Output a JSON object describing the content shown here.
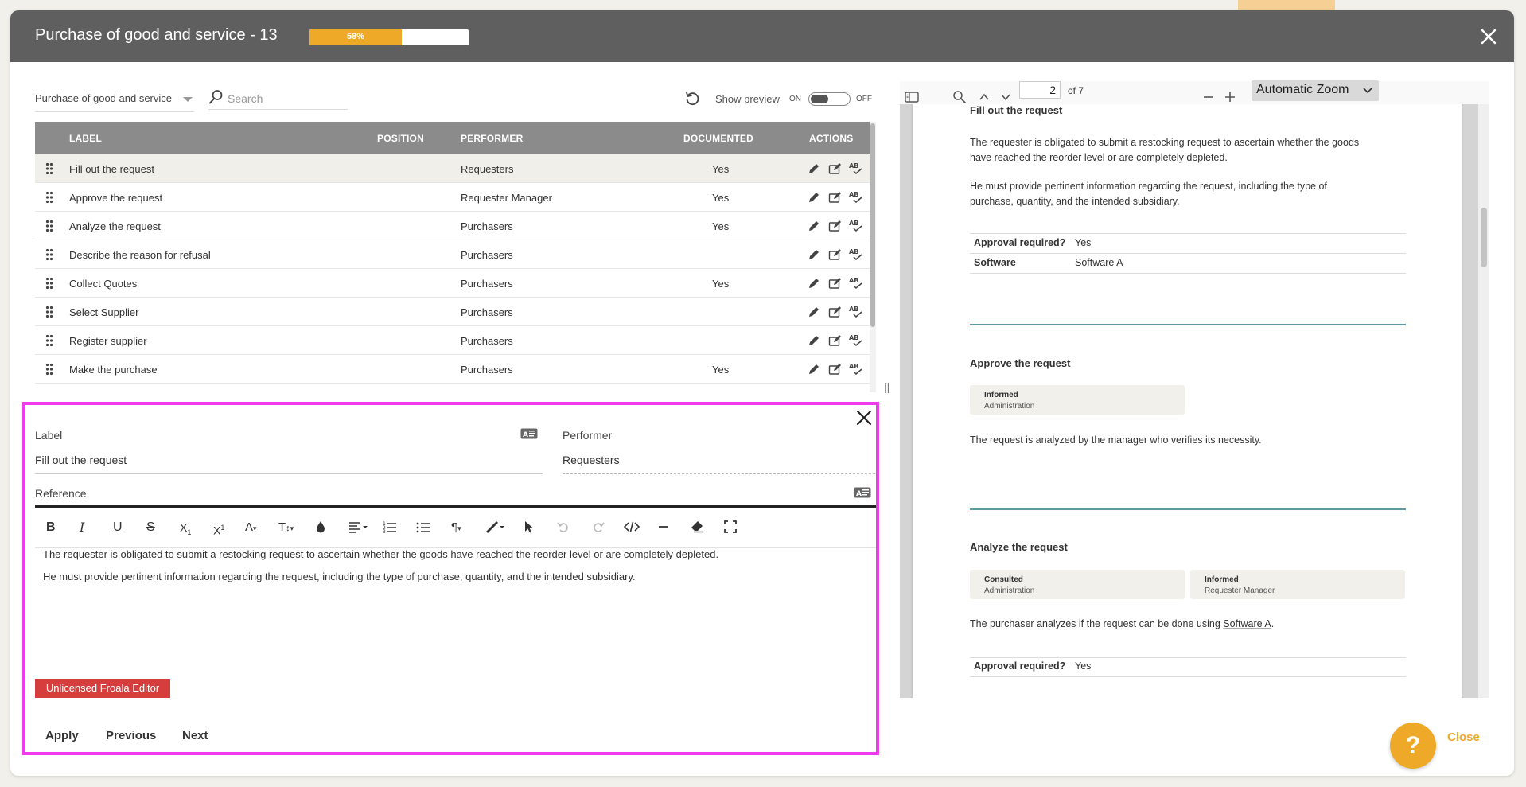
{
  "modal": {
    "title": "Purchase of good and service - 13",
    "progress_percent": 58,
    "progress_label": "58%"
  },
  "toolbar": {
    "filter_value": "Purchase of good and service",
    "search_placeholder": "Search",
    "show_preview_label": "Show preview",
    "toggle_on": "ON",
    "toggle_off": "OFF",
    "preview_enabled": true
  },
  "table": {
    "columns": [
      "LABEL",
      "POSITION",
      "PERFORMER",
      "DOCUMENTED",
      "ACTIONS"
    ],
    "rows": [
      {
        "label": "Fill out the request",
        "position": "",
        "performer": "Requesters",
        "documented": "Yes"
      },
      {
        "label": "Approve the request",
        "position": "",
        "performer": "Requester Manager",
        "documented": "Yes"
      },
      {
        "label": "Analyze the request",
        "position": "",
        "performer": "Purchasers",
        "documented": "Yes"
      },
      {
        "label": "Describe the reason for refusal",
        "position": "",
        "performer": "Purchasers",
        "documented": ""
      },
      {
        "label": "Collect Quotes",
        "position": "",
        "performer": "Purchasers",
        "documented": "Yes"
      },
      {
        "label": "Select Supplier",
        "position": "",
        "performer": "Purchasers",
        "documented": ""
      },
      {
        "label": "Register supplier",
        "position": "",
        "performer": "Purchasers",
        "documented": ""
      },
      {
        "label": "Make the purchase",
        "position": "",
        "performer": "Purchasers",
        "documented": "Yes"
      }
    ]
  },
  "edit_panel": {
    "label_title": "Label",
    "label_value": "Fill out the request",
    "performer_title": "Performer",
    "performer_value": "Requesters",
    "reference_title": "Reference",
    "editor_lines": [
      "The requester is obligated to submit a restocking request to ascertain whether the goods have reached the reorder level or are completely depleted.",
      "He must provide pertinent information regarding the request, including the type of purchase, quantity, and the intended subsidiary."
    ],
    "unlicensed_label": "Unlicensed Froala Editor",
    "apply_label": "Apply",
    "previous_label": "Previous",
    "next_label": "Next"
  },
  "pdf": {
    "page_number": "2",
    "page_total": "of 7",
    "zoom": "Automatic Zoom",
    "sections": {
      "s1_title": "Fill out the request",
      "s1_p1_l1": "The requester is obligated to submit a restocking request to ascertain whether the goods",
      "s1_p1_l2": "have reached the reorder level or are completely depleted.",
      "s1_p2_l1": "He must provide pertinent information regarding the request, including the type of",
      "s1_p2_l2": "purchase, quantity, and the intended subsidiary.",
      "s1_k1": "Approval required?",
      "s1_v1": "Yes",
      "s1_k2": "Software",
      "s1_v2": "Software A",
      "s2_title": "Approve the request",
      "s2_chip_title": "Informed",
      "s2_chip_sub": "Administration",
      "s2_p1": "The request is analyzed by the manager who verifies its necessity.",
      "s3_title": "Analyze the request",
      "s3_chip1_title": "Consulted",
      "s3_chip1_sub": "Administration",
      "s3_chip2_title": "Informed",
      "s3_chip2_sub": "Requester Manager",
      "s3_p1_prefix": "The purchaser analyzes if the request can be done using ",
      "s3_p1_link": "Software A",
      "s3_p1_suffix": ".",
      "s3_k1": "Approval required?",
      "s3_v1": "Yes"
    }
  },
  "footer": {
    "help_label": "?",
    "close_label": "Close"
  },
  "colors": {
    "accent": "#eea928",
    "header_bg": "#5f5f5f",
    "highlight_border": "#ee3cec",
    "unlicensed_bg": "#d63e3e"
  }
}
